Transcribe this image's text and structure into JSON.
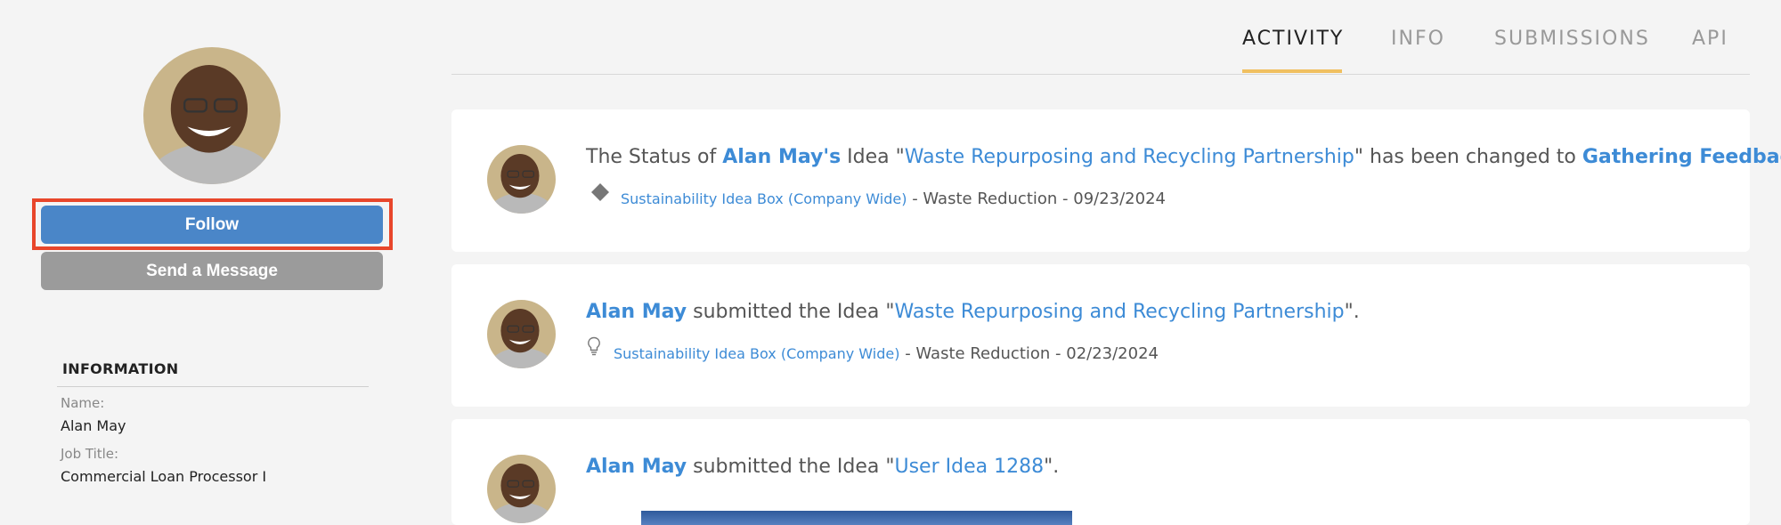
{
  "profile": {
    "follow_label": "Follow",
    "message_label": "Send a Message",
    "information": {
      "title": "INFORMATION",
      "name_label": "Name:",
      "name_value": "Alan May",
      "job_label": "Job Title:",
      "job_value": "Commercial Loan Processor I"
    }
  },
  "tabs": [
    {
      "label": "ACTIVITY",
      "active": true
    },
    {
      "label": "INFO",
      "active": false
    },
    {
      "label": "SUBMISSIONS",
      "active": false
    },
    {
      "label": "API",
      "active": false
    }
  ],
  "feed": [
    {
      "prefix": "The Status of ",
      "user": "Alan May's",
      "mid1": " Idea \"",
      "idea": "Waste Repurposing and Recycling Partnership",
      "mid2": "\" has been changed to ",
      "status": "Gathering Feedback",
      "suffix": ".",
      "icon": "diamond-icon",
      "box": "Sustainability Idea Box (Company Wide)",
      "meta": " - Waste Reduction - 09/23/2024"
    },
    {
      "user": "Alan May",
      "mid1": " submitted the Idea \"",
      "idea": "Waste Repurposing and Recycling Partnership",
      "suffix": "\".",
      "icon": "lightbulb-icon",
      "box": "Sustainability Idea Box (Company Wide)",
      "meta": " - Waste Reduction - 02/23/2024"
    },
    {
      "user": "Alan May",
      "mid1": " submitted the Idea \"",
      "idea": "User Idea 1288",
      "suffix": "\"."
    }
  ],
  "colors": {
    "link": "#3d8bd6",
    "follow_button": "#4a86c8",
    "message_button": "#9b9b9b",
    "highlight_frame": "#e8462b",
    "tab_underline": "#f0c060"
  }
}
